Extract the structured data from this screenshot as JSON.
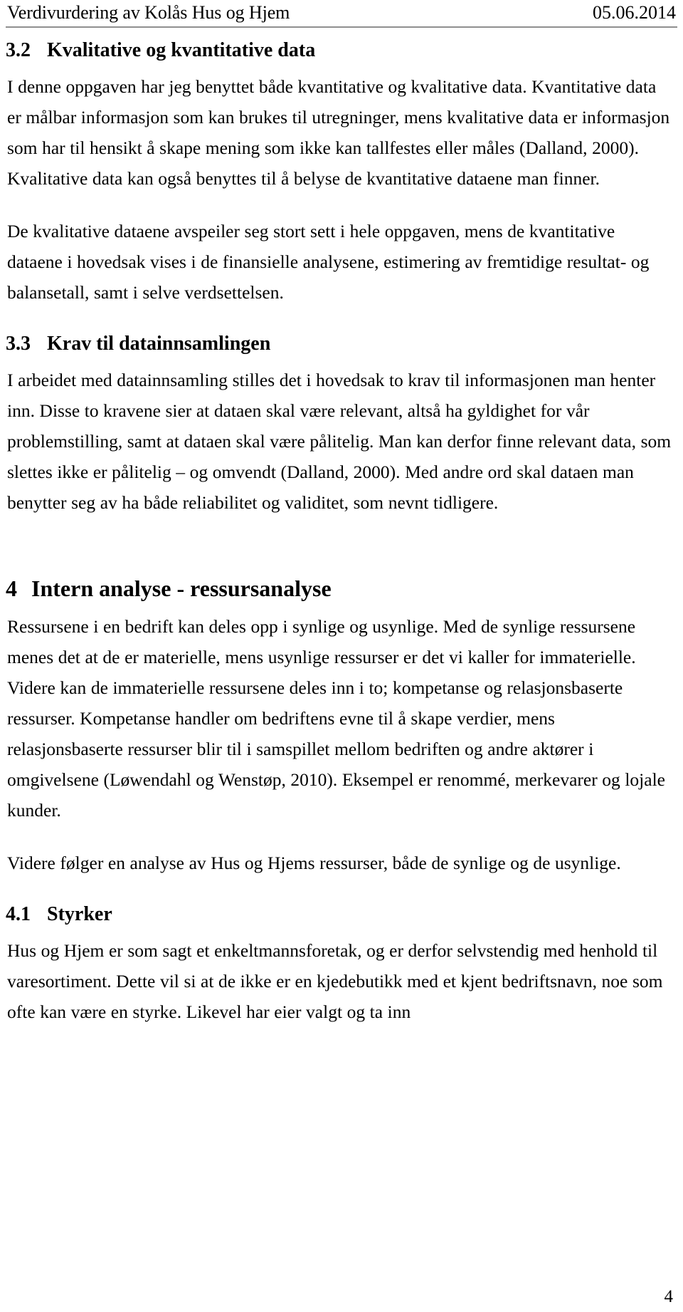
{
  "header": {
    "title": "Verdivurdering av Kolås Hus og Hjem",
    "date": "05.06.2014"
  },
  "sections": {
    "s32": {
      "number": "3.2",
      "title": "Kvalitative og kvantitative data",
      "p1": "I denne oppgaven har jeg benyttet både kvantitative og kvalitative data. Kvantitative data er målbar informasjon som kan brukes til utregninger, mens kvalitative data er informasjon som har til hensikt å skape mening som ikke kan tallfestes eller måles (Dalland, 2000). Kvalitative data kan også benyttes til å belyse de kvantitative dataene man finner.",
      "p2": "De kvalitative dataene avspeiler seg stort sett i hele oppgaven, mens de kvantitative dataene i hovedsak vises i de finansielle analysene, estimering av fremtidige resultat- og balansetall, samt i selve verdsettelsen."
    },
    "s33": {
      "number": "3.3",
      "title": "Krav til datainnsamlingen",
      "p1": "I arbeidet med datainnsamling stilles det i hovedsak to krav til informasjonen man henter inn. Disse to kravene sier at dataen skal være relevant, altså ha gyldighet for vår problemstilling, samt at dataen skal være pålitelig. Man kan derfor finne relevant data, som slettes ikke er pålitelig – og omvendt (Dalland, 2000). Med andre ord skal dataen man benytter seg av ha både reliabilitet og validitet, som nevnt tidligere."
    },
    "s4": {
      "number": "4",
      "title": "Intern analyse - ressursanalyse",
      "p1": "Ressursene i en bedrift kan deles opp i synlige og usynlige. Med de synlige ressursene menes det at de er materielle, mens usynlige ressurser er det vi kaller for immaterielle. Videre kan de immaterielle ressursene deles inn i to; kompetanse og relasjonsbaserte ressurser. Kompetanse handler om bedriftens evne til å skape verdier, mens relasjonsbaserte ressurser blir til i samspillet mellom bedriften og andre aktører i omgivelsene (Løwendahl og Wenstøp, 2010). Eksempel er renommé, merkevarer og lojale kunder.",
      "p2": "Videre følger en analyse av Hus og Hjems ressurser, både de synlige og de usynlige."
    },
    "s41": {
      "number": "4.1",
      "title": "Styrker",
      "p1": "Hus og Hjem er som sagt et enkeltmannsforetak, og er derfor selvstendig med henhold til varesortiment. Dette vil si at de ikke er en kjedebutikk med et kjent bedriftsnavn, noe som ofte kan være en styrke. Likevel har eier valgt og ta inn"
    }
  },
  "footer": {
    "page_number": "4"
  }
}
